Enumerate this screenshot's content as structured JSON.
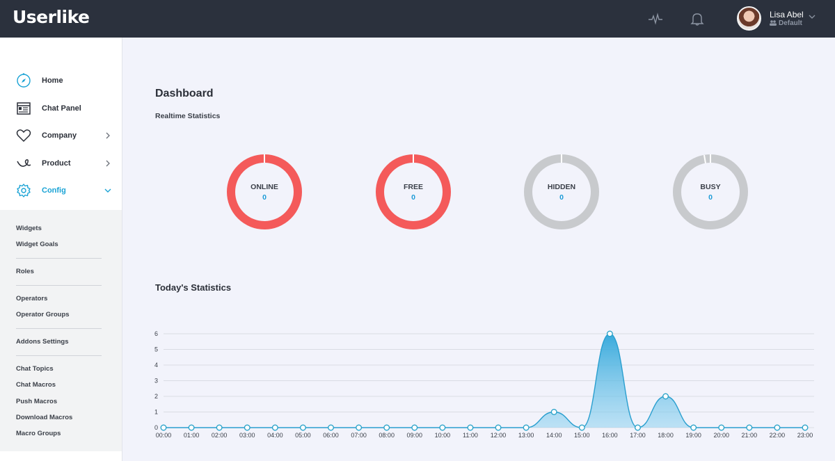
{
  "app": {
    "logo": "Userlike"
  },
  "header": {
    "activity_icon": "activity-icon",
    "notification_icon": "bell-icon",
    "user": {
      "name": "Lisa Abel",
      "role": "Default"
    }
  },
  "sidebar": {
    "items": [
      {
        "label": "Home",
        "icon": "compass-icon"
      },
      {
        "label": "Chat Panel",
        "icon": "chat-panel-icon"
      },
      {
        "label": "Company",
        "icon": "heart-icon"
      },
      {
        "label": "Product",
        "icon": "product-icon"
      },
      {
        "label": "Config",
        "icon": "gear-icon"
      }
    ],
    "submenu": [
      "Widgets",
      "Widget Goals",
      "Roles",
      "Operators",
      "Operator Groups",
      "Addons Settings",
      "Chat Topics",
      "Chat Macros",
      "Push Macros",
      "Download Macros",
      "Macro Groups"
    ]
  },
  "main": {
    "title": "Dashboard",
    "realtime_title": "Realtime Statistics",
    "today_title": "Today's Statistics"
  },
  "realtime": [
    {
      "label": "ONLINE",
      "value": "0",
      "color": "#f45a5a"
    },
    {
      "label": "FREE",
      "value": "0",
      "color": "#f45a5a"
    },
    {
      "label": "HIDDEN",
      "value": "0",
      "color": "#c8cacd"
    },
    {
      "label": "BUSY",
      "value": "0",
      "color": "#c8cacd"
    }
  ],
  "colors": {
    "accent": "#1aa3d5",
    "topbar": "#2b313d",
    "alert": "#f45a5a"
  },
  "chart_data": {
    "type": "area",
    "x": [
      "00:00",
      "01:00",
      "02:00",
      "03:00",
      "04:00",
      "05:00",
      "06:00",
      "07:00",
      "08:00",
      "09:00",
      "10:00",
      "11:00",
      "12:00",
      "13:00",
      "14:00",
      "15:00",
      "16:00",
      "17:00",
      "18:00",
      "19:00",
      "20:00",
      "21:00",
      "22:00",
      "23:00"
    ],
    "values": [
      0,
      0,
      0,
      0,
      0,
      0,
      0,
      0,
      0,
      0,
      0,
      0,
      0,
      0,
      1,
      0,
      6,
      0,
      2,
      0,
      0,
      0,
      0,
      0
    ],
    "yticks": [
      0,
      1,
      2,
      3,
      4,
      5,
      6
    ],
    "ylim": [
      0,
      6
    ],
    "grid": true
  }
}
